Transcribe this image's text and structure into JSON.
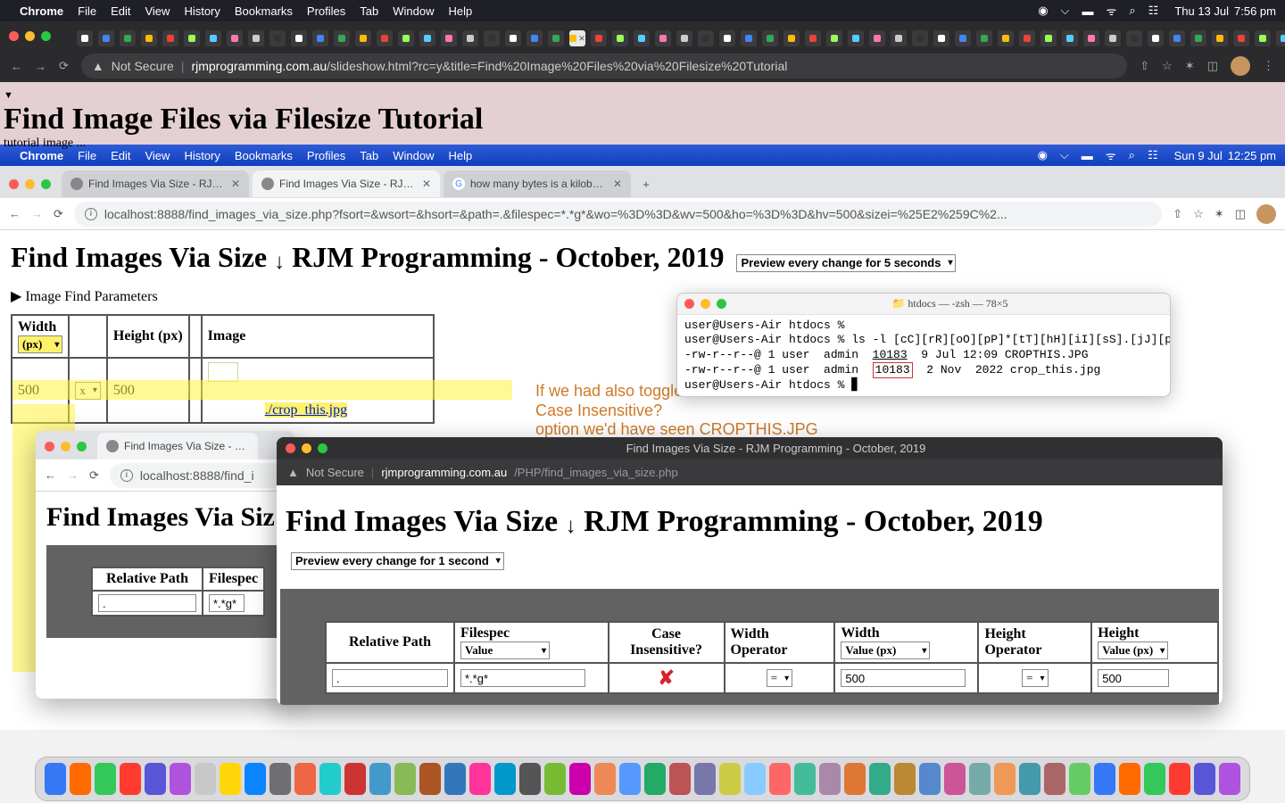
{
  "menubar_top": {
    "app": "Chrome",
    "items": [
      "File",
      "Edit",
      "View",
      "History",
      "Bookmarks",
      "Profiles",
      "Tab",
      "Window",
      "Help"
    ],
    "date": "Thu 13 Jul",
    "time": "7:56 pm"
  },
  "chrome_top": {
    "not_secure": "Not Secure",
    "url_bold": "rjmprogramming.com.au",
    "url_rest": "/slideshow.html?rc=y&title=Find%20Image%20Files%20via%20Filesize%20Tutorial"
  },
  "outer_page": {
    "title": "Find Image Files via Filesize Tutorial",
    "subtitle": "tutorial image ..."
  },
  "menubar2": {
    "app": "Chrome",
    "items": [
      "File",
      "Edit",
      "View",
      "History",
      "Bookmarks",
      "Profiles",
      "Tab",
      "Window",
      "Help"
    ],
    "date": "Sun 9 Jul",
    "time": "12:25 pm"
  },
  "chrome2": {
    "tabs": [
      {
        "label": "Find Images Via Size - RJM Pro",
        "active": false
      },
      {
        "label": "Find Images Via Size - RJM Pr",
        "active": true
      },
      {
        "label": "how many bytes is a kilobyte -",
        "active": false
      }
    ],
    "url": "localhost:8888/find_images_via_size.php?fsort=&wsort=&hsort=&path=.&filespec=*.*g*&wo=%3D%3D&wv=500&ho=%3D%3D&hv=500&sizei=%25E2%259C%2..."
  },
  "page2": {
    "heading": "Find Images Via Size ↓ RJM Programming - October, 2019",
    "arrow_glyph": "↓",
    "heading_pre": "Find Images Via Size",
    "heading_post": "RJM Programming - October, 2019",
    "preview_sel": "Preview every change for 5 seconds",
    "details": "Image Find Parameters",
    "col_width": "Width",
    "col_height": "Height (px)",
    "col_image": "Image",
    "px_sel": "(px)",
    "wv": "500",
    "hv": "500",
    "operator": "x",
    "croplink": "./crop_this.jpg",
    "annot1": "If we had also toggled the",
    "annot2": "Case Insensitive?",
    "annot3": "option we'd have seen CROPTHIS.JPG"
  },
  "terminal": {
    "title": "htdocs — -zsh — 78×5",
    "l1": "user@Users-Air htdocs %",
    "l2": "user@Users-Air htdocs % ls -l [cC][rR][oO][pP]*[tT][hH][iI][sS].[jJ][pP][gG]",
    "l3a": "-rw-r--r--@ 1 user  admin  ",
    "l3_size": "10183",
    "l3b": "  9 Jul 12:09 CROPTHIS.JPG",
    "l4a": "-rw-r--r--@ 1 user  admin  ",
    "l4_size": "10183",
    "l4b": "  2 Nov  2022 crop_this.jpg",
    "l5": "user@Users-Air htdocs % "
  },
  "chrome3": {
    "tab": "Find Images Via Size - RJM",
    "url": "localhost:8888/find_i"
  },
  "page3": {
    "heading_short": "Find Images Via Siz",
    "th_relpath": "Relative Path",
    "th_filespec": "Filespec",
    "td_relpath": ".",
    "td_filespec": "*.*g*"
  },
  "safari": {
    "title": "Find Images Via Size - RJM Programming - October, 2019",
    "not_secure": "Not Secure",
    "domain": "rjmprogramming.com.au",
    "path": "/PHP/find_images_via_size.php",
    "heading_pre": "Find Images Via Size",
    "heading_post": "RJM Programming - October, 2019",
    "preview_sel": "Preview every change for 1 second",
    "th_relpath": "Relative Path",
    "th_filespec": "Filespec",
    "filespec_sel": "Value",
    "th_case": "Case Insensitive?",
    "th_wop": "Width Operator",
    "th_width": "Width",
    "width_sel": "Value (px)",
    "th_hop": "Height Operator",
    "th_height": "Height",
    "height_sel": "Value (px)",
    "td_relpath": ".",
    "td_filespec": "*.*g*",
    "td_case_glyph": "✘",
    "td_wop": "=",
    "td_wval": "500",
    "td_hop": "=",
    "td_hval": "500"
  }
}
